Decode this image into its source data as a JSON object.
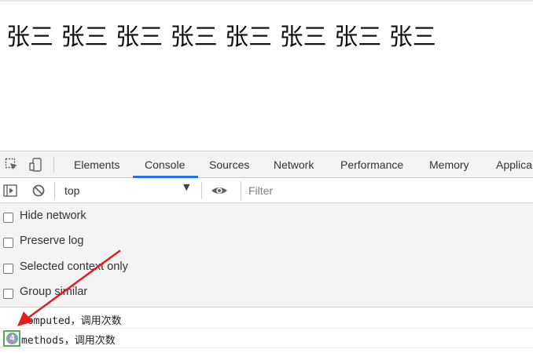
{
  "page": {
    "content_text": "张三 张三 张三 张三 张三 张三 张三 张三"
  },
  "devtools": {
    "tabs": [
      {
        "label": "Elements"
      },
      {
        "label": "Console"
      },
      {
        "label": "Sources"
      },
      {
        "label": "Network"
      },
      {
        "label": "Performance"
      },
      {
        "label": "Memory"
      },
      {
        "label": "Applica"
      }
    ],
    "active_tab": "Console",
    "toolbar_icons": [
      "inspect-element-icon",
      "device-toolbar-icon"
    ]
  },
  "console_toolbar": {
    "context": "top",
    "filter_placeholder": "Filter",
    "icons": [
      "sidebar-toggle-icon",
      "clear-console-icon",
      "eye-icon"
    ]
  },
  "settings": [
    {
      "label": "Hide network",
      "checked": false
    },
    {
      "label": "Preserve log",
      "checked": false
    },
    {
      "label": "Selected context only",
      "checked": false
    },
    {
      "label": "Group similar",
      "checked": false
    }
  ],
  "messages": [
    {
      "text": "computed，调用次数",
      "count": null
    },
    {
      "text": "methods，调用次数",
      "count": "4"
    }
  ],
  "colors": {
    "active_tab_underline": "#1a73e8",
    "annotation_arrow": "#e02020",
    "annotation_box": "#4caf50",
    "count_badge": "#8e9cae"
  }
}
